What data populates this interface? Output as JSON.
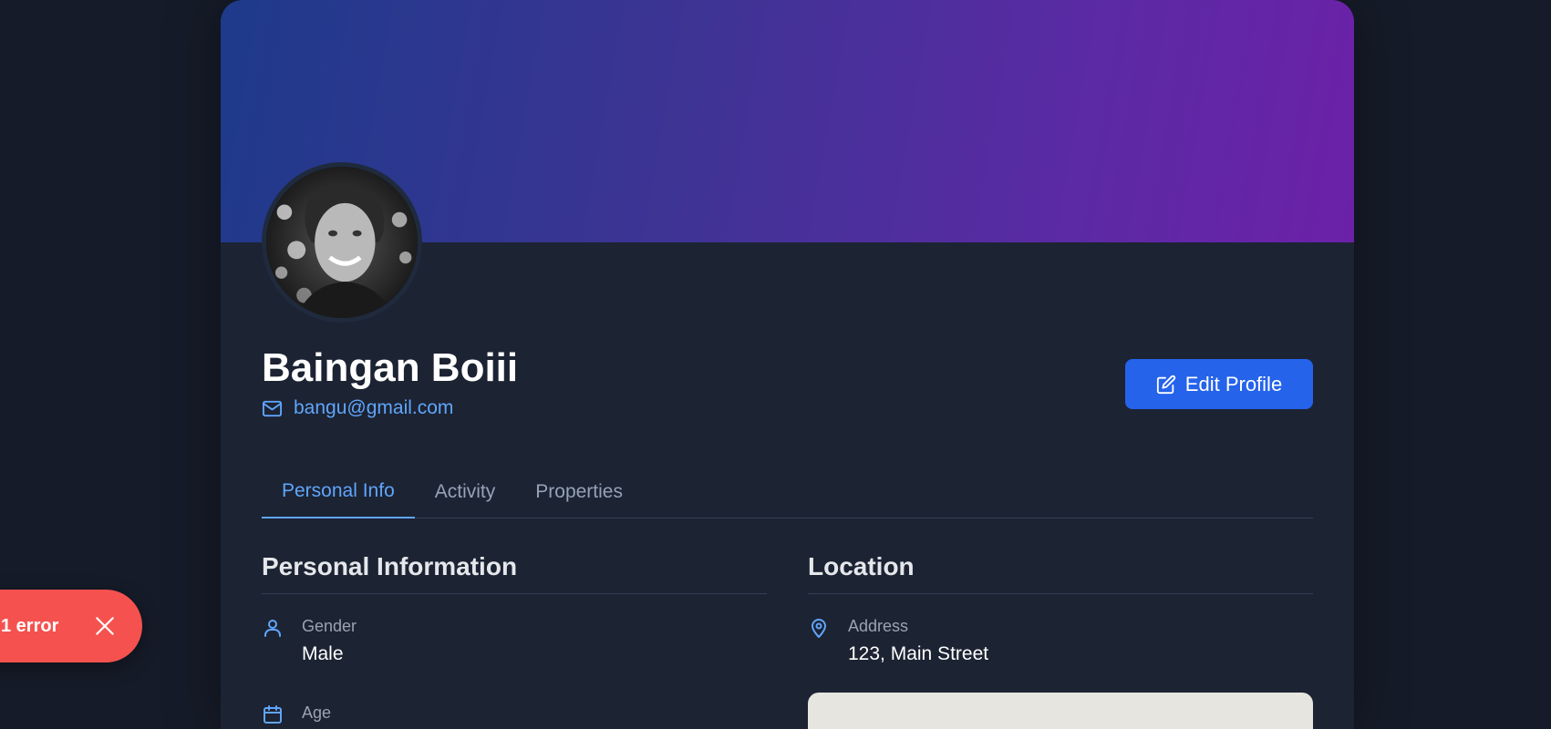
{
  "profile": {
    "name": "Baingan Boiii",
    "email": "bangu@gmail.com",
    "edit_label": "Edit Profile"
  },
  "tabs": [
    {
      "label": "Personal Info",
      "active": true
    },
    {
      "label": "Activity",
      "active": false
    },
    {
      "label": "Properties",
      "active": false
    }
  ],
  "personal": {
    "heading": "Personal Information",
    "gender_label": "Gender",
    "gender_value": "Male",
    "age_label": "Age"
  },
  "location": {
    "heading": "Location",
    "address_label": "Address",
    "address_value": "123, Main Street"
  },
  "toast": {
    "text": "1 error"
  },
  "colors": {
    "accent": "#60a5fa",
    "button": "#2563eb",
    "card": "#1c2333",
    "page": "#151b28",
    "error": "#f5524f",
    "banner_start": "#1e3a8a",
    "banner_end": "#6b21a8"
  },
  "icons": {
    "email": "mail-icon",
    "edit": "edit-icon",
    "gender": "user-icon",
    "age": "calendar-icon",
    "address": "map-pin-icon",
    "toast_close": "close-icon"
  }
}
